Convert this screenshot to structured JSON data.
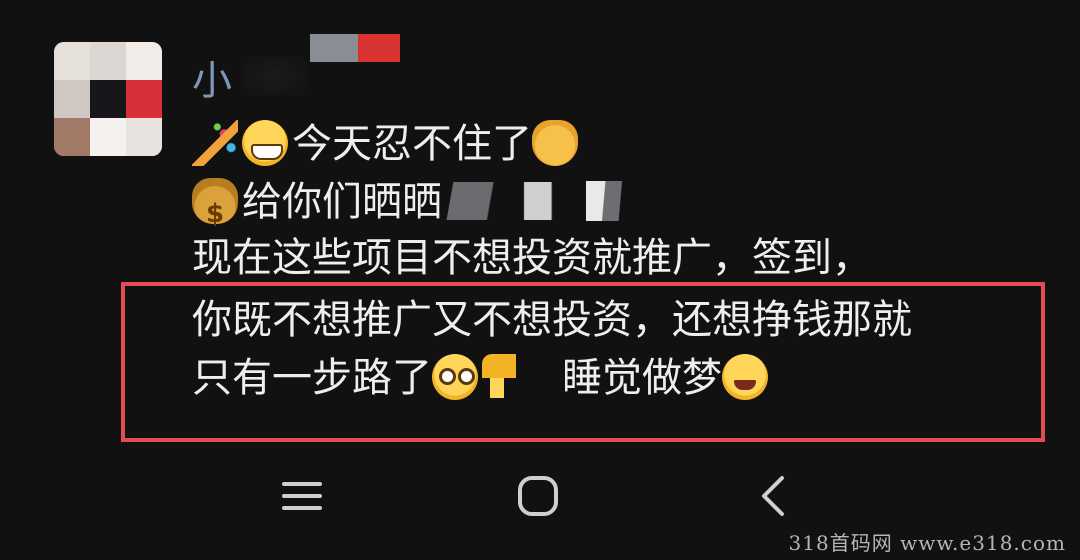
{
  "author": {
    "name": "小"
  },
  "message": {
    "line1_text": "今天忍不住了",
    "line2_text": "给你们晒晒",
    "line3_text": "现在这些项目不想投资就推广，签到，",
    "line4_text": "你既不想推广又不想投资，还想挣钱那就",
    "line5_text": "只有一步路了",
    "line5_tail": "睡觉做梦",
    "icons": [
      "party-popper-icon",
      "grinning-face-icon",
      "cat-face-icon",
      "money-bag-icon",
      "woozy-face-icon",
      "thumbs-down-icon",
      "laughing-crying-face-icon"
    ]
  },
  "annotation": {
    "color": "#e24c52"
  },
  "navbar": {
    "icons": [
      "recent-apps-icon",
      "home-icon",
      "back-icon"
    ]
  },
  "watermark": {
    "text": "318首码网   www.e318.com"
  },
  "colors": {
    "background": "#111112",
    "author_name": "#7f96b8",
    "text": "#eeeeee"
  }
}
